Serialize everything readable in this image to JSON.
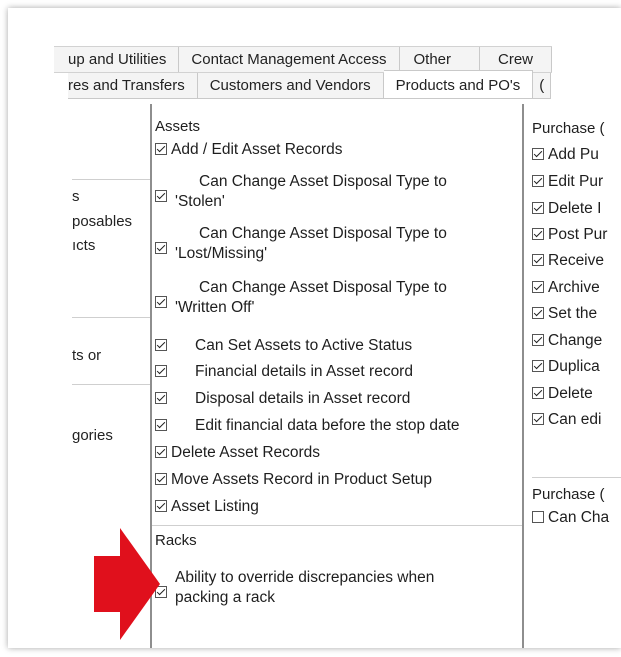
{
  "tabs_row1": [
    "up and Utilities",
    "Contact Management Access",
    "Other",
    "Crew"
  ],
  "tabs_row2": [
    "res and Transfers",
    "Customers and Vendors",
    "Products and PO's",
    "("
  ],
  "left_panel": [
    "s",
    "posables",
    "ıcts",
    "ts or",
    "gories"
  ],
  "assets": {
    "header": "Assets",
    "items": [
      {
        "label": "Add / Edit Asset Records",
        "checked": true
      },
      {
        "line1": "Can Change Asset Disposal Type to",
        "line2": "'Stolen'",
        "checked": true
      },
      {
        "line1": "Can Change Asset Disposal Type to",
        "line2": "'Lost/Missing'",
        "checked": true
      },
      {
        "line1": "Can Change Asset Disposal Type to",
        "line2": "'Written Off'",
        "checked": true
      },
      {
        "label": "Can Set Assets to Active Status",
        "checked": true
      },
      {
        "label": "Financial details in Asset record",
        "checked": true
      },
      {
        "label": "Disposal details in Asset record",
        "checked": true
      },
      {
        "label": "Edit financial data before the stop date",
        "checked": true
      },
      {
        "label": "Delete Asset Records",
        "checked": true
      },
      {
        "label": "Move Assets Record in Product Setup",
        "checked": true
      },
      {
        "label": "Asset Listing",
        "checked": true
      }
    ]
  },
  "racks": {
    "header": "Racks",
    "item_line1": "Ability to override discrepancies when",
    "item_line2": "packing a rack",
    "checked": true
  },
  "purchase": {
    "header": "Purchase (",
    "items": [
      "Add Pu",
      "Edit Pur",
      "Delete I",
      "Post Pur",
      "Receive",
      "Archive",
      "Set the",
      "Change",
      "Duplica",
      "Delete",
      "Can edi"
    ],
    "header2": "Purchase (",
    "item2": "Can Cha",
    "item2_checked": false
  },
  "colors": {
    "arrow": "#e0101c",
    "divider": "#8e8e8e"
  }
}
